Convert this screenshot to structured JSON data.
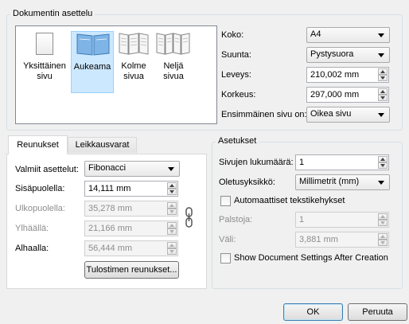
{
  "document_layout": {
    "title": "Dokumentin asettelu",
    "pages": [
      {
        "label_line1": "Yksittäinen",
        "label_line2": "sivu"
      },
      {
        "label_line1": "Aukeama",
        "label_line2": ""
      },
      {
        "label_line1": "Kolme",
        "label_line2": "sivua"
      },
      {
        "label_line1": "Neljä",
        "label_line2": "sivua"
      }
    ],
    "selected_page": "Aukeama",
    "size_label": "Koko:",
    "size_value": "A4",
    "orientation_label": "Suunta:",
    "orientation_value": "Pystysuora",
    "width_label": "Leveys:",
    "width_value": "210,002 mm",
    "height_label": "Korkeus:",
    "height_value": "297,000 mm",
    "first_page_label": "Ensimmäinen sivu on:",
    "first_page_value": "Oikea sivu"
  },
  "tabs": {
    "margins": "Reunukset",
    "bleeds": "Leikkausvarat",
    "active": "Reunukset"
  },
  "margins": {
    "preset_label": "Valmiit asettelut:",
    "preset_value": "Fibonacci",
    "inside_label": "Sisäpuolella:",
    "inside_value": "14,111 mm",
    "outside_label": "Ulkopuolella:",
    "outside_value": "35,278 mm",
    "top_label": "Ylhäällä:",
    "top_value": "21,166 mm",
    "bottom_label": "Alhaalla:",
    "bottom_value": "56,444 mm",
    "printer_margins_button": "Tulostimen reunukset..."
  },
  "settings": {
    "title": "Asetukset",
    "page_count_label": "Sivujen lukumäärä:",
    "page_count_value": "1",
    "default_unit_label": "Oletusyksikkö:",
    "default_unit_value": "Millimetrit (mm)",
    "auto_text_frames_label": "Automaattiset tekstikehykset",
    "auto_text_frames_checked": false,
    "columns_label": "Palstoja:",
    "columns_value": "1",
    "gap_label": "Väli:",
    "gap_value": "3,881 mm",
    "show_settings_label": "Show Document Settings After Creation",
    "show_settings_checked": false
  },
  "footer": {
    "ok_label": "OK",
    "cancel_label": "Peruuta"
  }
}
